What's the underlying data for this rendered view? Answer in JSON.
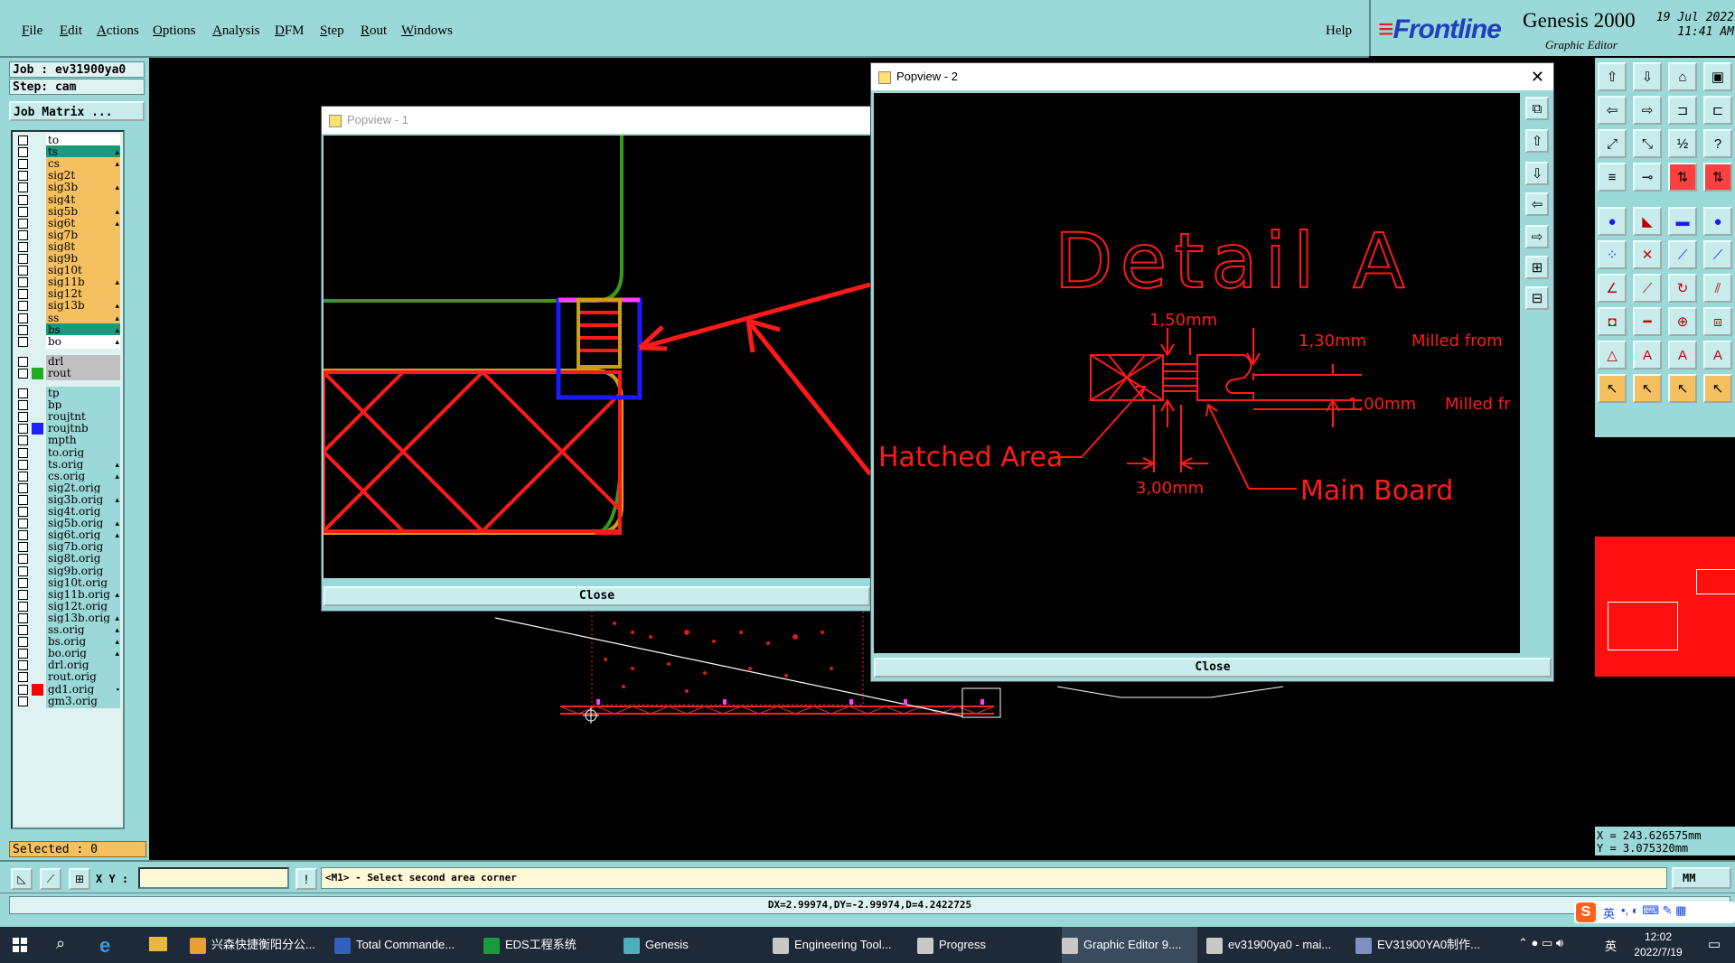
{
  "menu": [
    "File",
    "Edit",
    "Actions",
    "Options",
    "Analysis",
    "DFM",
    "Step",
    "Rout",
    "Windows"
  ],
  "help": "Help",
  "brand": {
    "logo": "Frontline",
    "product": "Genesis 2000",
    "subtitle": "Graphic Editor",
    "date": "19 Jul 2022",
    "time": "11:41 AM"
  },
  "job": {
    "job": "Job : ev31900ya0",
    "step": "Step: cam",
    "matrix": "Job Matrix ..."
  },
  "layers": [
    {
      "name": "to",
      "color": "#ffffff",
      "mark": "",
      "bg": "#ffffff"
    },
    {
      "name": "ts",
      "color": "#1a9a7a",
      "mark": "▴",
      "bg": "#1a9a7a"
    },
    {
      "name": "cs",
      "color": "#f5c060",
      "mark": "▴",
      "bg": "#f5c060"
    },
    {
      "name": "sig2t",
      "color": "#f5c060",
      "mark": "",
      "bg": "#f5c060"
    },
    {
      "name": "sig3b",
      "color": "#f5c060",
      "mark": "▴",
      "bg": "#f5c060"
    },
    {
      "name": "sig4t",
      "color": "#f5c060",
      "mark": "",
      "bg": "#f5c060"
    },
    {
      "name": "sig5b",
      "color": "#f5c060",
      "mark": "▴",
      "bg": "#f5c060"
    },
    {
      "name": "sig6t",
      "color": "#f5c060",
      "mark": "▴",
      "bg": "#f5c060"
    },
    {
      "name": "sig7b",
      "color": "#f5c060",
      "mark": "",
      "bg": "#f5c060"
    },
    {
      "name": "sig8t",
      "color": "#f5c060",
      "mark": "",
      "bg": "#f5c060"
    },
    {
      "name": "sig9b",
      "color": "#f5c060",
      "mark": "",
      "bg": "#f5c060"
    },
    {
      "name": "sig10t",
      "color": "#f5c060",
      "mark": "",
      "bg": "#f5c060"
    },
    {
      "name": "sig11b",
      "color": "#f5c060",
      "mark": "▴",
      "bg": "#f5c060"
    },
    {
      "name": "sig12t",
      "color": "#f5c060",
      "mark": "",
      "bg": "#f5c060"
    },
    {
      "name": "sig13b",
      "color": "#f5c060",
      "mark": "▴",
      "bg": "#f5c060"
    },
    {
      "name": "ss",
      "color": "#f5c060",
      "mark": "▴",
      "bg": "#f5c060"
    },
    {
      "name": "bs",
      "color": "#1a9a7a",
      "mark": "▴",
      "bg": "#1a9a7a"
    },
    {
      "name": "bo",
      "color": "#ffffff",
      "mark": "▴",
      "bg": "#ffffff"
    },
    {
      "name": "drl",
      "color": "#c0c0c0",
      "mark": "",
      "bg": "#c0c0c0"
    },
    {
      "name": "rout",
      "color": "#c0c0c0",
      "mark": "",
      "bg": "#c0c0c0"
    },
    {
      "name": "tp",
      "color": "#9bd8d8",
      "mark": "",
      "bg": "#9bd8d8"
    },
    {
      "name": "bp",
      "color": "#9bd8d8",
      "mark": "",
      "bg": "#9bd8d8"
    },
    {
      "name": "roujtnt",
      "color": "#9bd8d8",
      "mark": "",
      "bg": "#9bd8d8"
    },
    {
      "name": "roujtnb",
      "color": "#9bd8d8",
      "mark": "",
      "bg": "#9bd8d8"
    },
    {
      "name": "mpth",
      "color": "#9bd8d8",
      "mark": "",
      "bg": "#9bd8d8"
    },
    {
      "name": "to.orig",
      "color": "#9bd8d8",
      "mark": "",
      "bg": "#9bd8d8"
    },
    {
      "name": "ts.orig",
      "color": "#9bd8d8",
      "mark": "▴",
      "bg": "#9bd8d8"
    },
    {
      "name": "cs.orig",
      "color": "#9bd8d8",
      "mark": "▴",
      "bg": "#9bd8d8"
    },
    {
      "name": "sig2t.orig",
      "color": "#9bd8d8",
      "mark": "",
      "bg": "#9bd8d8"
    },
    {
      "name": "sig3b.orig",
      "color": "#9bd8d8",
      "mark": "▴",
      "bg": "#9bd8d8"
    },
    {
      "name": "sig4t.orig",
      "color": "#9bd8d8",
      "mark": "",
      "bg": "#9bd8d8"
    },
    {
      "name": "sig5b.orig",
      "color": "#9bd8d8",
      "mark": "▴",
      "bg": "#9bd8d8"
    },
    {
      "name": "sig6t.orig",
      "color": "#9bd8d8",
      "mark": "▴",
      "bg": "#9bd8d8"
    },
    {
      "name": "sig7b.orig",
      "color": "#9bd8d8",
      "mark": "",
      "bg": "#9bd8d8"
    },
    {
      "name": "sig8t.orig",
      "color": "#9bd8d8",
      "mark": "",
      "bg": "#9bd8d8"
    },
    {
      "name": "sig9b.orig",
      "color": "#9bd8d8",
      "mark": "",
      "bg": "#9bd8d8"
    },
    {
      "name": "sig10t.orig",
      "color": "#9bd8d8",
      "mark": "",
      "bg": "#9bd8d8"
    },
    {
      "name": "sig11b.orig",
      "color": "#9bd8d8",
      "mark": "▴",
      "bg": "#9bd8d8"
    },
    {
      "name": "sig12t.orig",
      "color": "#9bd8d8",
      "mark": "",
      "bg": "#9bd8d8"
    },
    {
      "name": "sig13b.orig",
      "color": "#9bd8d8",
      "mark": "▴",
      "bg": "#9bd8d8"
    },
    {
      "name": "ss.orig",
      "color": "#9bd8d8",
      "mark": "▴",
      "bg": "#9bd8d8"
    },
    {
      "name": "bs.orig",
      "color": "#9bd8d8",
      "mark": "▴",
      "bg": "#9bd8d8"
    },
    {
      "name": "bo.orig",
      "color": "#9bd8d8",
      "mark": "▴",
      "bg": "#9bd8d8"
    },
    {
      "name": "drl.orig",
      "color": "#9bd8d8",
      "mark": "",
      "bg": "#9bd8d8"
    },
    {
      "name": "rout.orig",
      "color": "#9bd8d8",
      "mark": "",
      "bg": "#9bd8d8"
    },
    {
      "name": "gd1.orig",
      "color": "#9bd8d8",
      "mark": "▪",
      "bg": "#9bd8d8"
    },
    {
      "name": "gm3.orig",
      "color": "#9bd8d8",
      "mark": "",
      "bg": "#9bd8d8"
    }
  ],
  "layer_swatches": {
    "sig12t": "",
    "rout": "#22aa22",
    "roujtnb": "#2020ff",
    "gd1.orig": "#ff0000"
  },
  "selected": "Selected : 0",
  "popup1": {
    "title": "Popview - 1",
    "close": "Close"
  },
  "popup2": {
    "title": "Popview - 2",
    "close": "Close",
    "detail_title": "Detail A",
    "labels": {
      "d150": "1,50mm",
      "d130": "1,30mm",
      "milled1": "Milled from",
      "d100": "1,00mm",
      "milled2": "Milled fr",
      "hatched": "Hatched Area",
      "d300": "3,00mm",
      "mainboard": "Main Board"
    }
  },
  "coords": {
    "x": "X = 243.626575mm",
    "y": "Y = 3.075320mm"
  },
  "cmd": {
    "xy_label": "X Y :",
    "message": "<M1> - Select second area corner",
    "unit": "MM"
  },
  "status": "DX=2.99974,DY=-2.99974,D=4.2422725",
  "taskbar": {
    "items": [
      {
        "label": "兴森快捷衡阳分公...",
        "color": "#e8a030"
      },
      {
        "label": "Total Commande...",
        "color": "#3060c0"
      },
      {
        "label": "EDS工程系统",
        "color": "#1a9a3a"
      },
      {
        "label": "Genesis",
        "color": "#4ab0c0"
      },
      {
        "label": "Engineering Tool...",
        "color": "#c8c8c8"
      },
      {
        "label": "Progress",
        "color": "#c8c8c8"
      },
      {
        "label": "Graphic Editor 9....",
        "color": "#c8c8c8"
      },
      {
        "label": "ev31900ya0 - mai...",
        "color": "#c8c8c8"
      },
      {
        "label": "EV31900YA0制作...",
        "color": "#8090c0"
      }
    ],
    "ime": "英",
    "clock_time": "12:02",
    "clock_date": "2022/7/19"
  }
}
